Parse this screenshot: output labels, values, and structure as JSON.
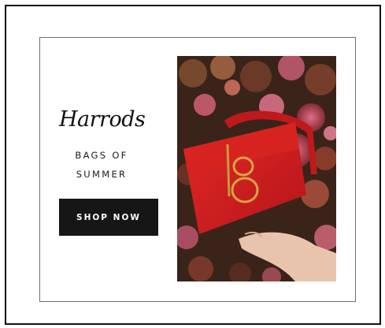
{
  "ad": {
    "brand_logo_text": "Harrods",
    "tagline_line1": "BAGS OF",
    "tagline_line2": "SUMMER",
    "cta_label": "SHOP NOW",
    "photo_icon": "red-handbag-on-flowers"
  },
  "colors": {
    "cta_background": "#161616",
    "cta_text": "#ffffff",
    "bag_red": "#d3191b",
    "border": "#111111"
  }
}
